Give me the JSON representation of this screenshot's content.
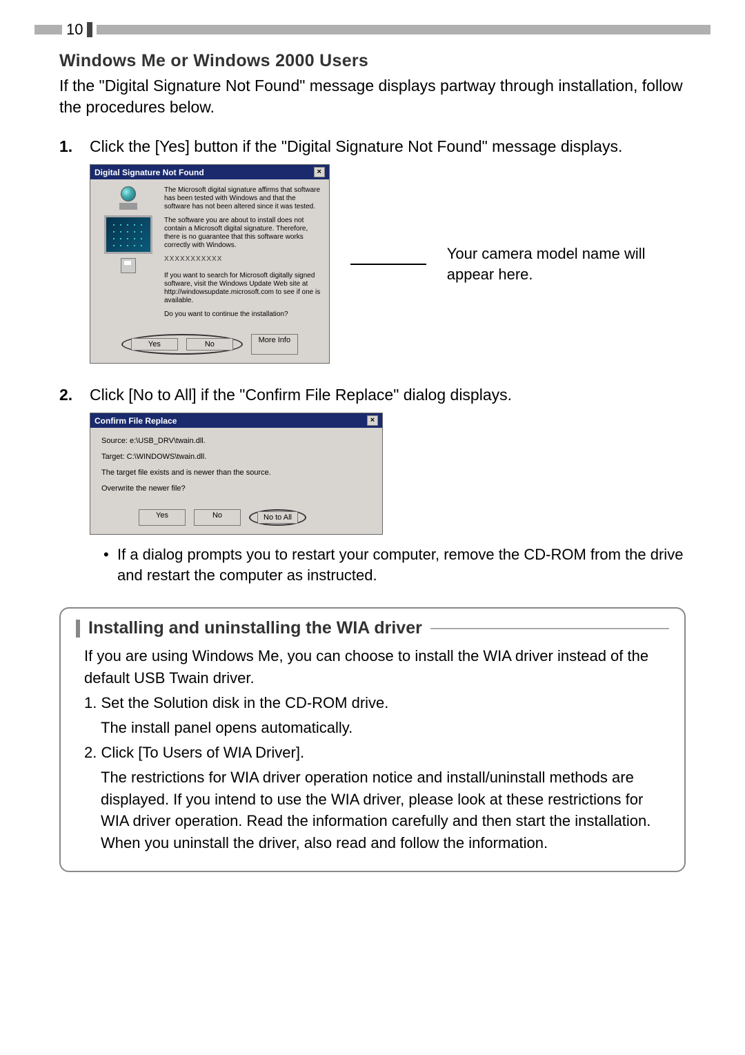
{
  "page_number": "10",
  "section_heading": "Windows Me or Windows 2000 Users",
  "intro": "If the \"Digital Signature Not Found\" message displays partway through installation, follow the procedures below.",
  "step1_num": "1.",
  "step1_text": "Click the [Yes] button if the \"Digital Signature Not Found\" message displays.",
  "dialog1": {
    "title": "Digital Signature Not Found",
    "p1": "The Microsoft digital signature affirms that software has been tested with Windows and that the software has not been altered since it was tested.",
    "p2": "The software you are about to install does not contain a Microsoft digital signature. Therefore, there is no guarantee that this software works correctly with Windows.",
    "placeholder": "XXXXXXXXXXX",
    "p3": "If you want to search for Microsoft digitally signed software, visit the Windows Update Web site at http://windowsupdate.microsoft.com to see if one is available.",
    "p4": "Do you want to continue the installation?",
    "btn_yes": "Yes",
    "btn_no": "No",
    "btn_more": "More Info"
  },
  "callout": "Your camera model name will appear here.",
  "step2_num": "2.",
  "step2_text": "Click [No to All] if the \"Confirm File Replace\" dialog displays.",
  "dialog2": {
    "title": "Confirm File Replace",
    "source": "Source: e:\\USB_DRV\\twain.dll.",
    "target": "Target: C:\\WINDOWS\\twain.dll.",
    "msg": "The target file exists and is newer than the source.",
    "q": "Overwrite the newer file?",
    "btn_yes": "Yes",
    "btn_no": "No",
    "btn_notoall": "No to All"
  },
  "bullet_text": "If a dialog prompts you to restart your computer, remove the CD-ROM from the drive and restart the computer as instructed.",
  "info": {
    "title": "Installing and uninstalling the WIA driver",
    "intro": "If you are using Windows Me, you can choose to install the WIA driver instead of the default USB Twain driver.",
    "n1": "1. Set the Solution disk in the CD-ROM drive.",
    "n1b": "The install panel opens automatically.",
    "n2": "2. Click [To Users of WIA Driver].",
    "n2b": "The restrictions for WIA driver operation notice and install/uninstall methods are displayed. If you intend to use the WIA driver, please look at these restrictions for WIA driver operation. Read the information carefully and then start the installation. When you uninstall the driver, also read and follow the information."
  }
}
